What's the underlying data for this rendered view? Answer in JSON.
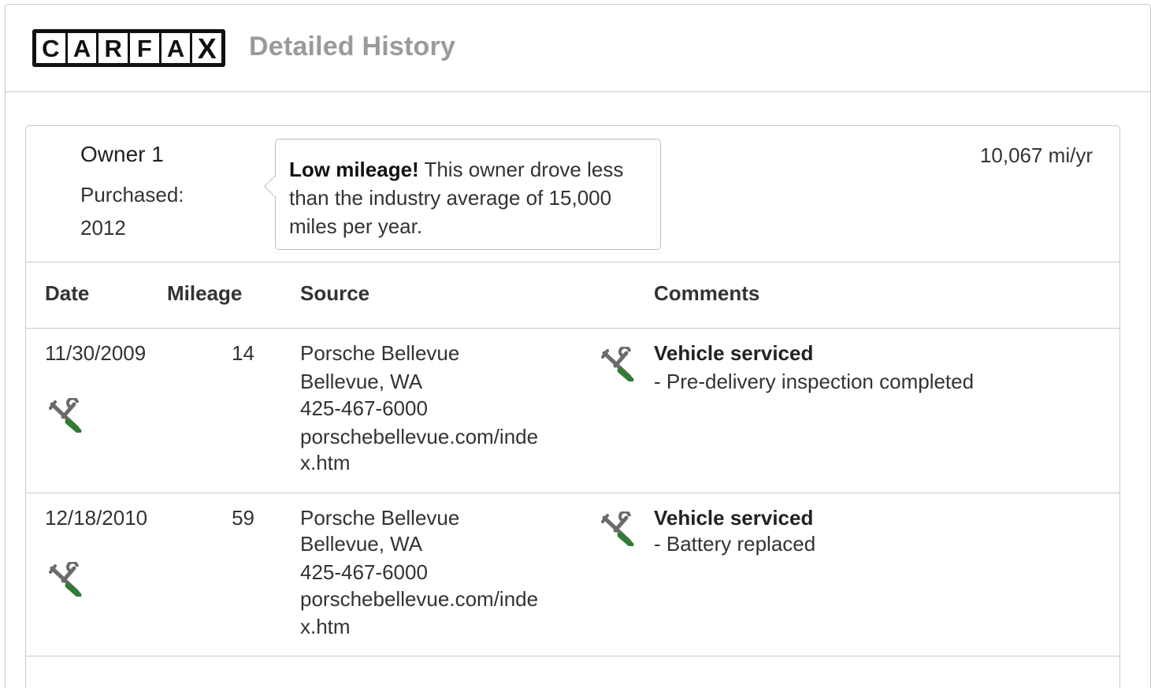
{
  "header": {
    "logo_letters": [
      "C",
      "A",
      "R",
      "F",
      "A",
      "X"
    ],
    "title": "Detailed History"
  },
  "owner": {
    "name": "Owner 1",
    "purchased_label": "Purchased:",
    "purchased_year": "2012",
    "mileage_rate": "10,067 mi/yr",
    "callout": {
      "bold": "Low mileage!",
      "text": " This owner drove less than the industry average of 15,000 miles per year."
    }
  },
  "table": {
    "columns": [
      "Date",
      "Mileage",
      "Source",
      "Comments"
    ],
    "rows": [
      {
        "date": "11/30/2009",
        "mileage": "14",
        "source": [
          "Porsche Bellevue",
          "Bellevue, WA",
          "425-467-6000",
          "porschebellevue.com/inde",
          "x.htm"
        ],
        "comment_title": "Vehicle serviced",
        "comment_detail": "- Pre-delivery inspection completed",
        "icon": "service-tools-icon"
      },
      {
        "date": "12/18/2010",
        "mileage": "59",
        "source": [
          "Porsche Bellevue",
          "Bellevue, WA",
          "425-467-6000",
          "porschebellevue.com/inde",
          "x.htm"
        ],
        "comment_title": "Vehicle serviced",
        "comment_detail": "- Battery replaced",
        "icon": "service-tools-icon"
      }
    ]
  },
  "colors": {
    "wrench": "#6b6b6b",
    "screwdriver": "#2e7d32",
    "border": "#c9c9c9",
    "title_gray": "#9a9a9a"
  }
}
